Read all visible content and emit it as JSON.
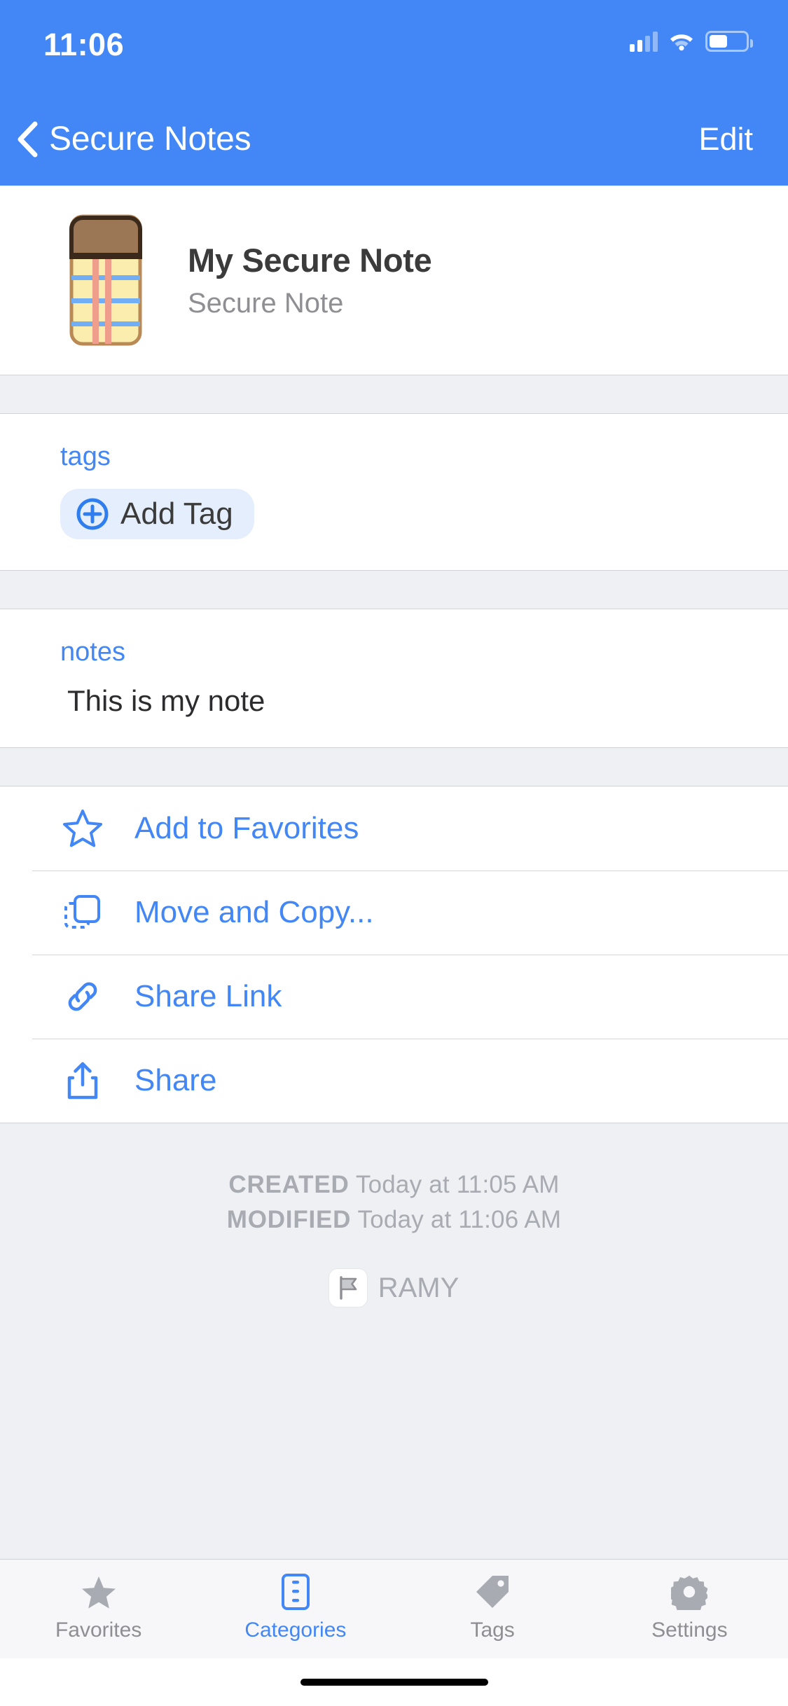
{
  "status_bar": {
    "time": "11:06",
    "cellular_icon": "cellular-signal-icon",
    "wifi_icon": "wifi-icon",
    "battery_icon": "battery-icon"
  },
  "nav_bar": {
    "back_icon": "chevron-left-icon",
    "back_title": "Secure Notes",
    "edit_label": "Edit",
    "background_color": "#4287f5"
  },
  "item": {
    "icon": "notepad-icon",
    "title": "My Secure Note",
    "subtitle": "Secure Note"
  },
  "tags_section": {
    "label": "tags",
    "add_tag_icon": "plus-circle-icon",
    "add_tag_label": "Add Tag"
  },
  "notes_section": {
    "label": "notes",
    "value": "This is my note"
  },
  "actions": [
    {
      "icon": "star-outline-icon",
      "label": "Add to Favorites"
    },
    {
      "icon": "move-copy-icon",
      "label": "Move and Copy..."
    },
    {
      "icon": "link-icon",
      "label": "Share Link"
    },
    {
      "icon": "share-up-arrow-icon",
      "label": "Share"
    }
  ],
  "metadata": {
    "created_label": "CREATED",
    "created_value": "Today at 11:05 AM",
    "modified_label": "MODIFIED",
    "modified_value": "Today at 11:06 AM",
    "vault_icon": "vault-flag-icon",
    "vault_name": "RAMY"
  },
  "tab_bar": {
    "tabs": [
      {
        "icon": "star-filled-icon",
        "label": "Favorites",
        "active": false
      },
      {
        "icon": "categories-icon",
        "label": "Categories",
        "active": true
      },
      {
        "icon": "tag-icon",
        "label": "Tags",
        "active": false
      },
      {
        "icon": "gear-icon",
        "label": "Settings",
        "active": false
      }
    ],
    "active_color": "#4287f5",
    "inactive_color": "#8e8e93"
  },
  "home_indicator": "home-indicator"
}
